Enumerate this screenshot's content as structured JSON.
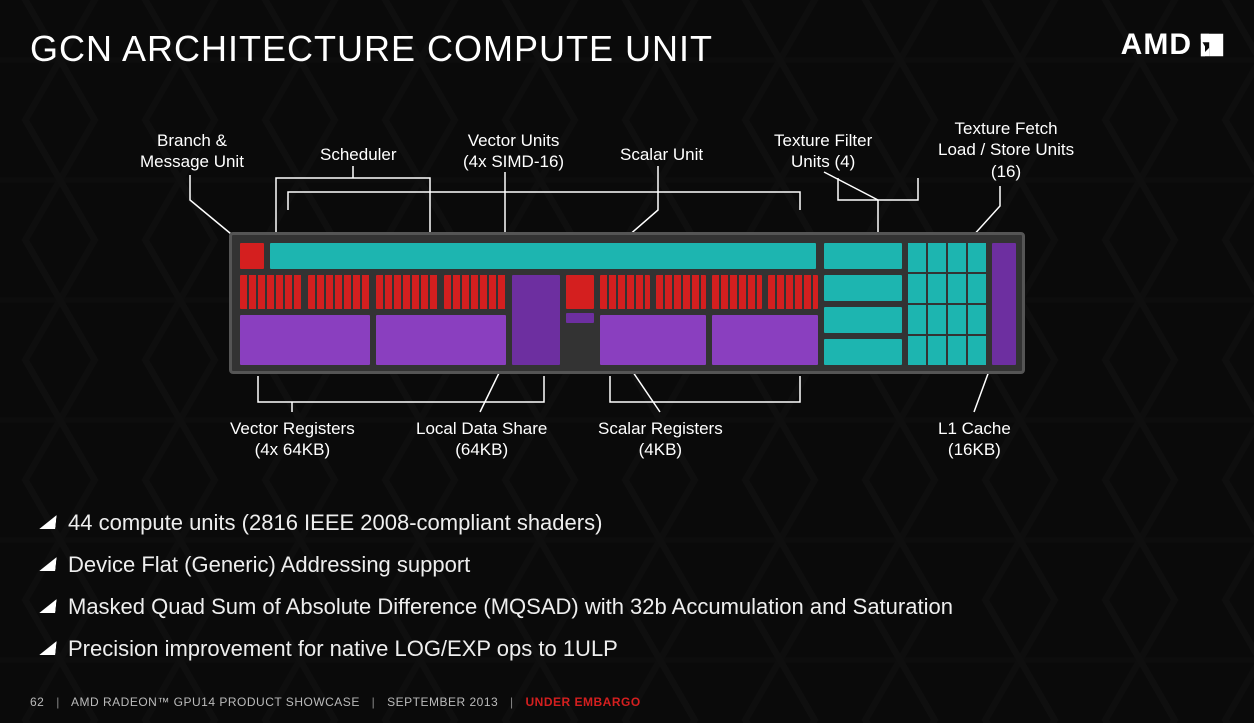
{
  "title": "GCN ARCHITECTURE COMPUTE UNIT",
  "brand": "AMD",
  "labels_top": {
    "branch_msg": "Branch &\nMessage Unit",
    "scheduler": "Scheduler",
    "vector_units": "Vector Units\n(4x SIMD-16)",
    "scalar_unit": "Scalar Unit",
    "tex_filter": "Texture Filter\nUnits (4)",
    "tex_fetch": "Texture Fetch\nLoad / Store Units\n(16)"
  },
  "labels_bottom": {
    "vector_regs": "Vector Registers\n(4x 64KB)",
    "lds": "Local Data Share\n(64KB)",
    "scalar_regs": "Scalar Registers\n(4KB)",
    "l1": "L1 Cache\n(16KB)"
  },
  "bullets": [
    "44 compute units (2816 IEEE 2008-compliant shaders)",
    "Device Flat  (Generic) Addressing support",
    "Masked Quad Sum of Absolute Difference (MQSAD) with 32b Accumulation and Saturation",
    "Precision improvement for native LOG/EXP ops to 1ULP"
  ],
  "footer": {
    "page": "62",
    "product": "AMD RADEON™ GPU14 PRODUCT SHOWCASE",
    "date": "SEPTEMBER 2013",
    "embargo": "UNDER EMBARGO"
  },
  "colors": {
    "teal": "#1db5b0",
    "red": "#d41f1f",
    "purple": "#8a3fbf",
    "dark": "#333333"
  }
}
